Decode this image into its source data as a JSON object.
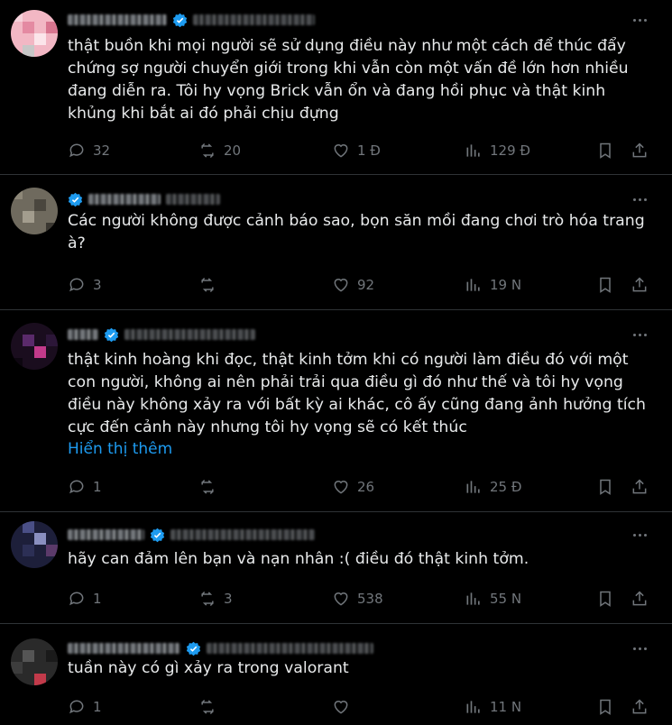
{
  "show_more_label": "Hiển thị thêm",
  "colors": {
    "background": "#000000",
    "text": "#e7e9ea",
    "muted": "#71767b",
    "link": "#1d9bf0",
    "divider": "#2f3336",
    "verified": "#1d9bf0"
  },
  "icons": [
    "more-icon",
    "verified-badge-icon",
    "reply-icon",
    "repost-icon",
    "like-icon",
    "views-icon",
    "bookmark-icon",
    "share-icon"
  ],
  "posts": [
    {
      "text": "thật buồn khi mọi người sẽ sử dụng điều này như một cách để thúc đẩy chứng sợ người chuyển giới trong khi vẫn còn một vấn đề lớn hơn nhiều đang diễn ra. Tôi hy vọng Brick vẫn ổn và đang hồi phục và thật kinh khủng khi bắt ai đó phải chịu đựng",
      "replies": "32",
      "reposts": "20",
      "likes": "1 Đ",
      "views": "129 Đ"
    },
    {
      "text": "Các người không được cảnh báo sao, bọn săn mồi đang chơi trò hóa trang à?",
      "replies": "3",
      "reposts": "",
      "likes": "92",
      "views": "19 N"
    },
    {
      "text": "thật kinh hoàng khi đọc, thật kinh tởm khi có người làm điều đó với một con người, không ai nên phải trải qua điều gì đó như thế và tôi hy vọng điều này không xảy ra với bất kỳ ai khác, cô ấy cũng đang ảnh hưởng tích cực đến cảnh này nhưng tôi hy vọng sẽ có kết thúc",
      "replies": "1",
      "reposts": "",
      "likes": "26",
      "views": "25 Đ"
    },
    {
      "text": "hãy can đảm lên bạn và nạn nhân :( điều đó thật kinh tởm.",
      "replies": "1",
      "reposts": "3",
      "likes": "538",
      "views": "55 N"
    },
    {
      "text": "tuần này có gì xảy ra trong valorant",
      "replies": "1",
      "reposts": "",
      "likes": "",
      "views": "11 N"
    }
  ]
}
